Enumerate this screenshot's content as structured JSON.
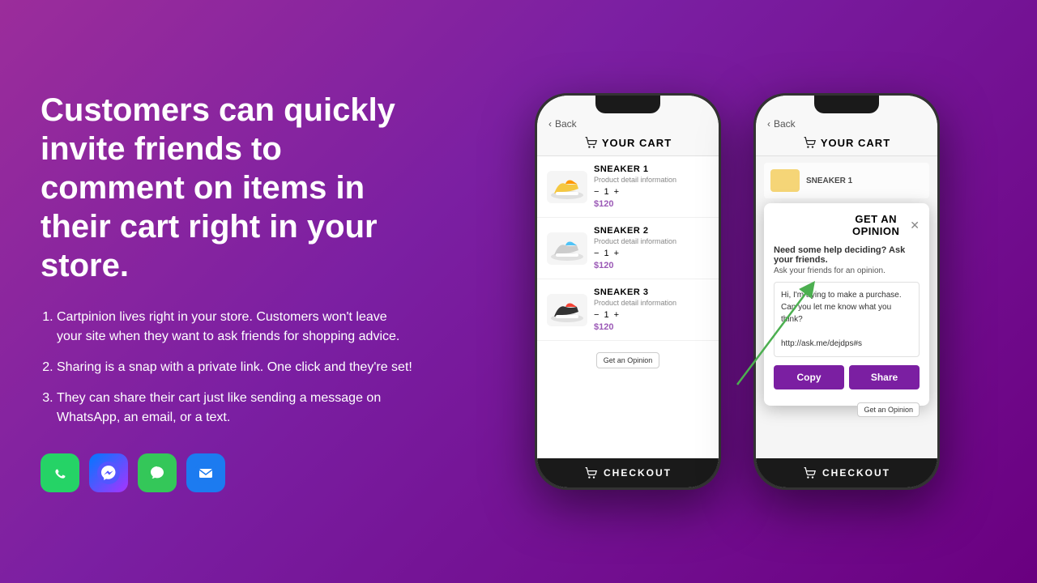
{
  "background": "#8b1a9a",
  "left": {
    "heading": "Customers can quickly invite friends to comment on items in their cart right in your store.",
    "features": [
      {
        "text": "Cartpinion lives right in your store. Customers won't leave your site when they want to ask friends for shopping advice."
      },
      {
        "text": "Sharing is a snap with a private link. One click and they're set!"
      },
      {
        "text": "They can share their cart just like sending a message on WhatsApp, an email, or a text."
      }
    ],
    "app_icons": [
      "whatsapp",
      "messenger",
      "imessage",
      "mail"
    ]
  },
  "phone1": {
    "back_label": "Back",
    "cart_title": "YOUR CART",
    "items": [
      {
        "name": "SNEAKER 1",
        "desc": "Product detail information",
        "qty": "1",
        "price": "$120",
        "emoji": "👟",
        "color": "#f5c842"
      },
      {
        "name": "SNEAKER 2",
        "desc": "Product detail information",
        "qty": "1",
        "price": "$120",
        "emoji": "👟",
        "color": "#cccccc"
      },
      {
        "name": "SNEAKER 3",
        "desc": "Product detail information",
        "qty": "1",
        "price": "$120",
        "emoji": "👟",
        "color": "#222222"
      }
    ],
    "get_opinion_btn": "Get an Opinion",
    "checkout_label": "CHECKOUT"
  },
  "phone2": {
    "back_label": "Back",
    "cart_title": "YOUR CART",
    "sneaker1_label": "SNEAKER 1",
    "checkout_label": "CHECKOUT",
    "modal": {
      "title": "GET AN OPINION",
      "subtitle": "Need some help deciding? Ask your friends.",
      "sub2": "Ask your friends for an opinion.",
      "message": "Hi, I'm trying to make a purchase. Can you let me know what you think?\n\nhttp://ask.me/dejdps#s",
      "copy_label": "Copy",
      "share_label": "Share",
      "get_opinion_btn": "Get an Opinion"
    }
  }
}
